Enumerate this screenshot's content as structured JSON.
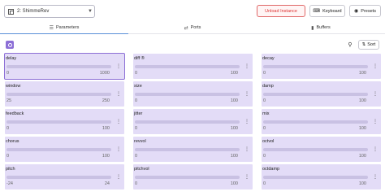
{
  "header": {
    "instance": "2: ShimmeRev",
    "unload_label": "Unload Instance",
    "keyboard_label": "Keyboard",
    "presets_label": "Presets"
  },
  "tabs": [
    {
      "label": "Parameters",
      "icon": "sliders-icon",
      "active": true
    },
    {
      "label": "Ports",
      "icon": "arrows-icon",
      "active": false
    },
    {
      "label": "Buffers",
      "icon": "file-icon",
      "active": false
    }
  ],
  "toolbar": {
    "sort_label": "Sort"
  },
  "params": [
    {
      "name": "delay",
      "min": "0",
      "max": "1000",
      "selected": true
    },
    {
      "name": "diff ®",
      "min": "0",
      "max": "100"
    },
    {
      "name": "decay",
      "min": "0",
      "max": "100"
    },
    {
      "name": "window",
      "min": "25",
      "max": "250"
    },
    {
      "name": "size",
      "min": "0",
      "max": "100"
    },
    {
      "name": "damp",
      "min": "0",
      "max": "100"
    },
    {
      "name": "feedback",
      "min": "0",
      "max": "100"
    },
    {
      "name": "jitter",
      "min": "0",
      "max": "100"
    },
    {
      "name": "mix",
      "min": "0",
      "max": "100"
    },
    {
      "name": "chorus",
      "min": "0",
      "max": "100"
    },
    {
      "name": "revvol",
      "min": "0",
      "max": "100"
    },
    {
      "name": "octvol",
      "min": "0",
      "max": "100"
    },
    {
      "name": "pitch",
      "min": "-24",
      "max": "24"
    },
    {
      "name": "pitchvol",
      "min": "0",
      "max": "100"
    },
    {
      "name": "octdamp",
      "min": "0",
      "max": "100"
    }
  ]
}
